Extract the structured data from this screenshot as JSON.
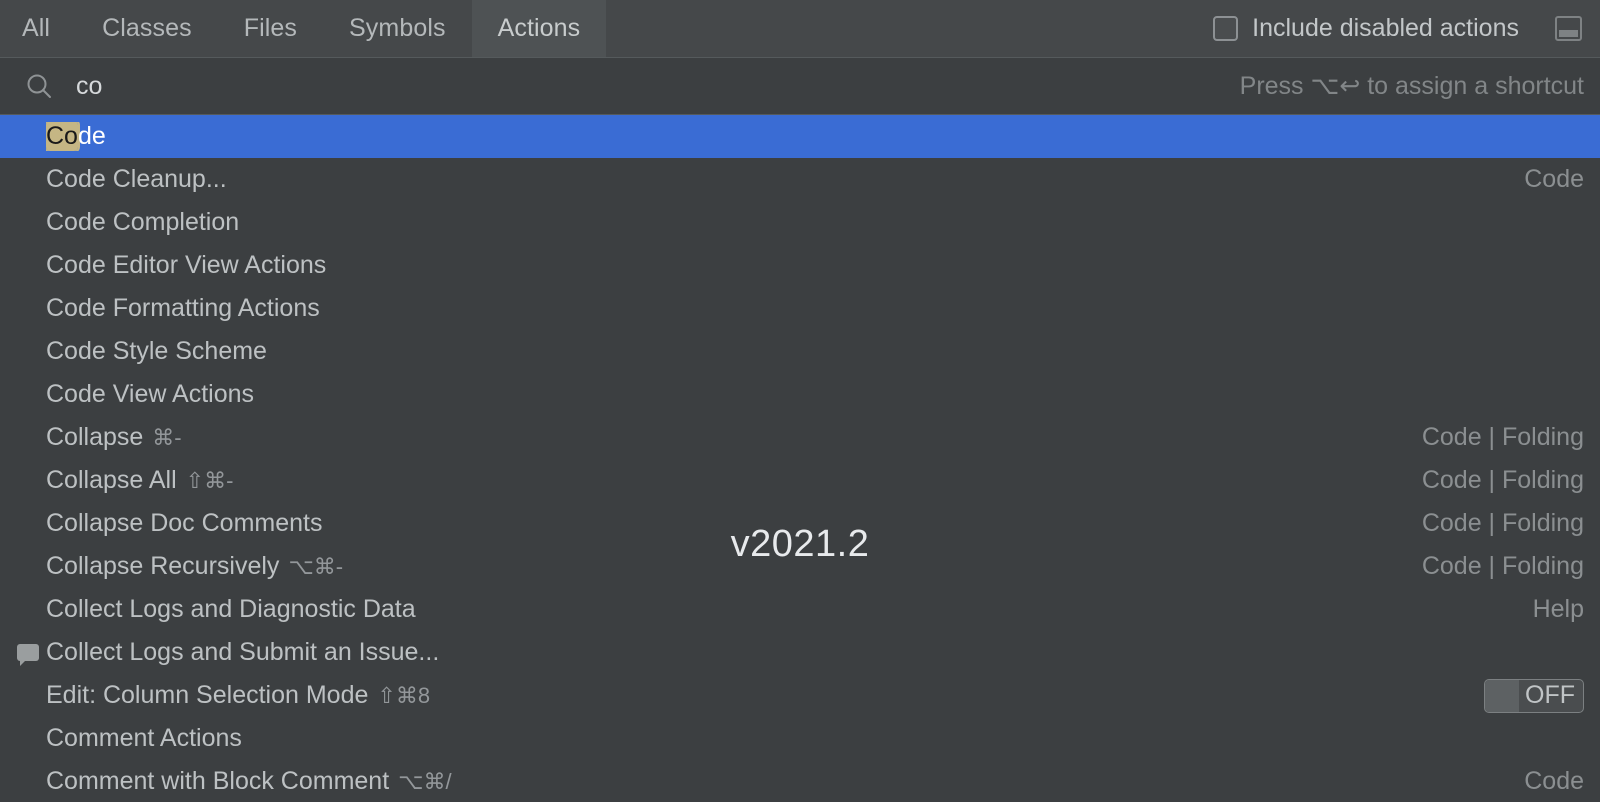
{
  "tabs": [
    {
      "label": "All",
      "selected": false
    },
    {
      "label": "Classes",
      "selected": false
    },
    {
      "label": "Files",
      "selected": false
    },
    {
      "label": "Symbols",
      "selected": false
    },
    {
      "label": "Actions",
      "selected": true
    }
  ],
  "header": {
    "include_disabled_label": "Include disabled actions",
    "include_disabled_checked": false,
    "window_icon": "panel-window-icon"
  },
  "search": {
    "icon": "search-icon",
    "value": "co",
    "placeholder": "",
    "hint": "Press ⌥↩ to assign a shortcut"
  },
  "watermark": "v2021.2",
  "colors": {
    "background": "#3c3f41",
    "tabbar": "#45484a",
    "tab_selected": "#4e5254",
    "selection": "#3a6cd4",
    "match_highlight": "#c5b684",
    "text": "#bdc1c3",
    "text_dim": "#8b8f91"
  },
  "results": [
    {
      "label": "Code",
      "match": "Co",
      "shortcut": "",
      "group": "",
      "icon": "",
      "selected": true,
      "toggle": null
    },
    {
      "label": "Code Cleanup...",
      "match": "",
      "shortcut": "",
      "group": "Code",
      "icon": "",
      "selected": false,
      "toggle": null
    },
    {
      "label": "Code Completion",
      "match": "",
      "shortcut": "",
      "group": "",
      "icon": "",
      "selected": false,
      "toggle": null
    },
    {
      "label": "Code Editor View Actions",
      "match": "",
      "shortcut": "",
      "group": "",
      "icon": "",
      "selected": false,
      "toggle": null
    },
    {
      "label": "Code Formatting Actions",
      "match": "",
      "shortcut": "",
      "group": "",
      "icon": "",
      "selected": false,
      "toggle": null
    },
    {
      "label": "Code Style Scheme",
      "match": "",
      "shortcut": "",
      "group": "",
      "icon": "",
      "selected": false,
      "toggle": null
    },
    {
      "label": "Code View Actions",
      "match": "",
      "shortcut": "",
      "group": "",
      "icon": "",
      "selected": false,
      "toggle": null
    },
    {
      "label": "Collapse",
      "match": "",
      "shortcut": "⌘-",
      "group": "Code | Folding",
      "icon": "",
      "selected": false,
      "toggle": null
    },
    {
      "label": "Collapse All",
      "match": "",
      "shortcut": "⇧⌘-",
      "group": "Code | Folding",
      "icon": "",
      "selected": false,
      "toggle": null
    },
    {
      "label": "Collapse Doc Comments",
      "match": "",
      "shortcut": "",
      "group": "Code | Folding",
      "icon": "",
      "selected": false,
      "toggle": null
    },
    {
      "label": "Collapse Recursively",
      "match": "",
      "shortcut": "⌥⌘-",
      "group": "Code | Folding",
      "icon": "",
      "selected": false,
      "toggle": null
    },
    {
      "label": "Collect Logs and Diagnostic Data",
      "match": "",
      "shortcut": "",
      "group": "Help",
      "icon": "",
      "selected": false,
      "toggle": null
    },
    {
      "label": "Collect Logs and Submit an Issue...",
      "match": "",
      "shortcut": "",
      "group": "",
      "icon": "speech-bubble-icon",
      "selected": false,
      "toggle": null
    },
    {
      "label": "Edit: Column Selection Mode",
      "match": "",
      "shortcut": "⇧⌘8",
      "group": "",
      "icon": "",
      "selected": false,
      "toggle": "OFF"
    },
    {
      "label": "Comment Actions",
      "match": "",
      "shortcut": "",
      "group": "",
      "icon": "",
      "selected": false,
      "toggle": null
    },
    {
      "label": "Comment with Block Comment",
      "match": "",
      "shortcut": "⌥⌘/",
      "group": "Code",
      "icon": "",
      "selected": false,
      "toggle": null
    }
  ]
}
